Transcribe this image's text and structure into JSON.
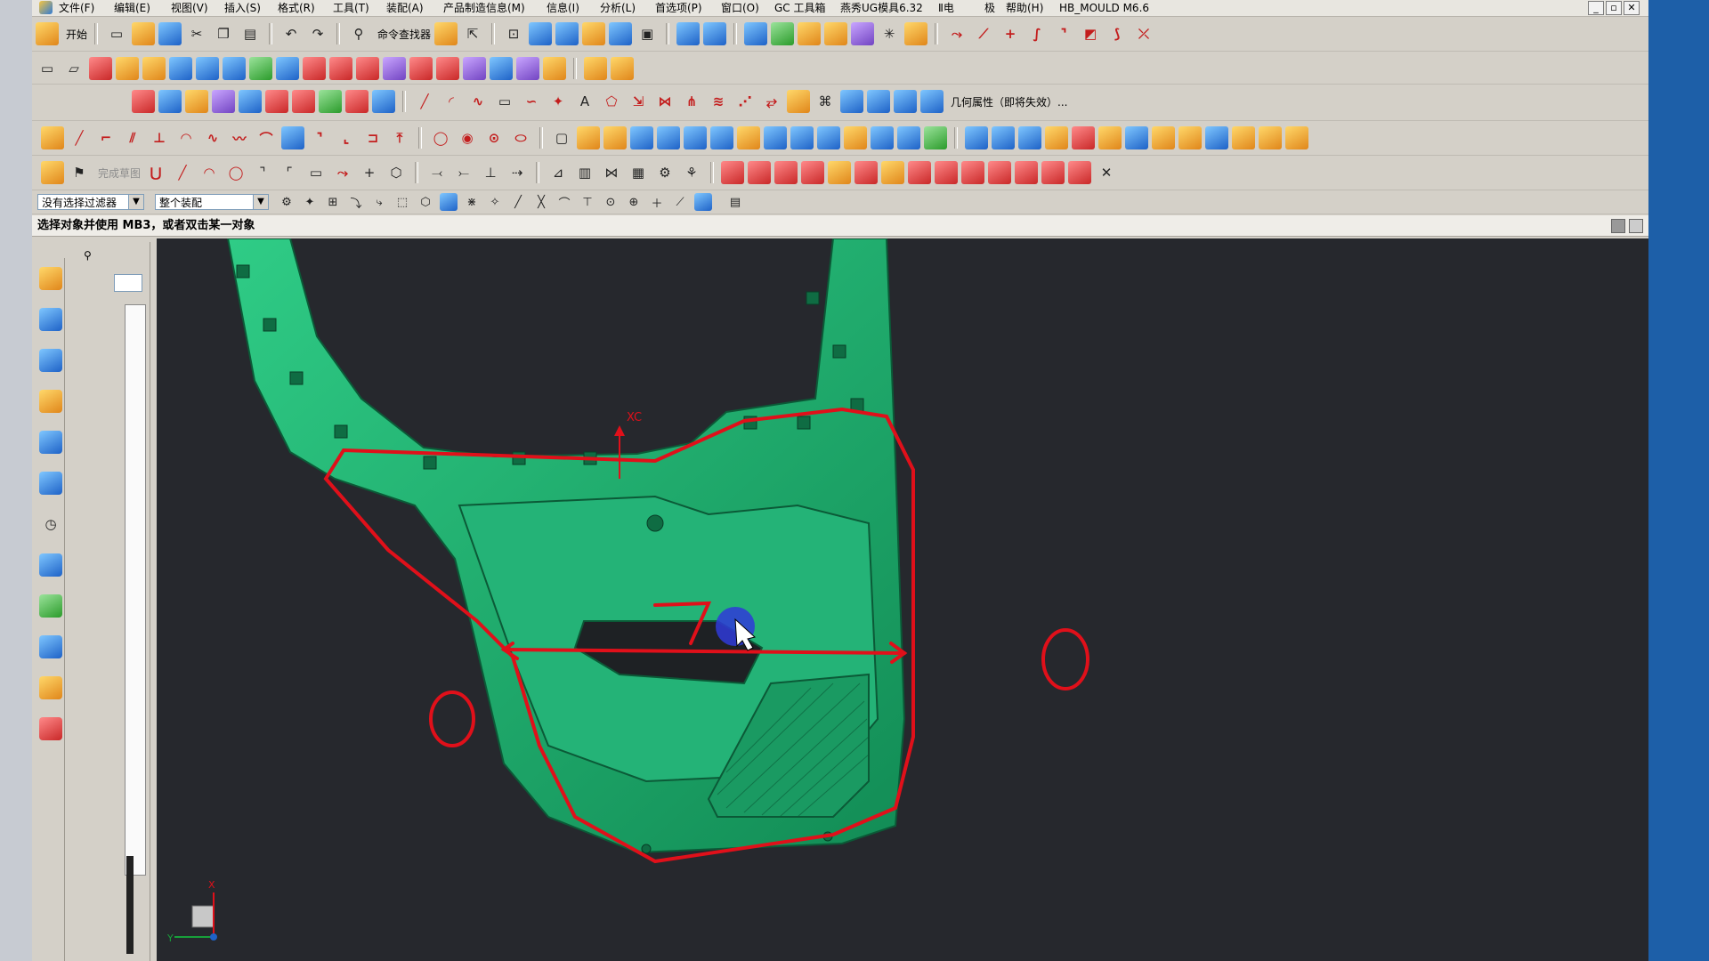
{
  "window": {
    "menus": [
      "文件(F)",
      "编辑(E)",
      "视图(V)",
      "插入(S)",
      "格式(R)",
      "工具(T)",
      "装配(A)",
      "产品制造信息(M)",
      "信息(I)",
      "分析(L)",
      "首选项(P)",
      "窗口(O)",
      "GC 工具箱",
      "燕秀UG模具6.32",
      "Ⅱ电",
      "极",
      "帮助(H)",
      "HB_MOULD M6.6"
    ],
    "controls": {
      "minimize": "_",
      "restore": "▫",
      "close": "✕"
    }
  },
  "toolbar1": {
    "start_label": "开始",
    "command_finder_label": "命令查找器"
  },
  "toolbar3": {
    "geometry_props_label": "几何属性（即将失效）..."
  },
  "toolbar5": {
    "sketch_label": "完成草图"
  },
  "selection_bar": {
    "filter_value": "没有选择过滤器",
    "scope_value": "整个装配"
  },
  "cue_line": {
    "text": "选择对象并使用 MB3，或者双击某一对象"
  },
  "nav_panel": {
    "header_icon": "part-navigator-icon"
  },
  "viewport": {
    "wcs_label": "XC",
    "triad_labels": {
      "x": "X",
      "y": "Y"
    },
    "colors": {
      "background": "#26282d",
      "part": "#1ea86e",
      "annotation": "#e0101a"
    }
  }
}
